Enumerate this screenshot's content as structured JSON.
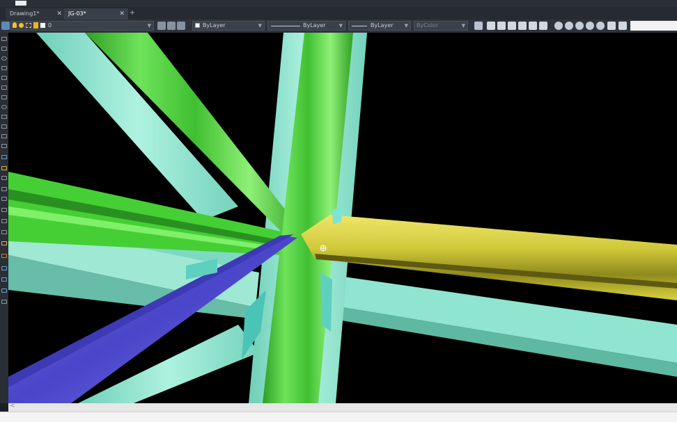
{
  "app": {
    "title": ""
  },
  "tabs": [
    {
      "label": "Drawing1*",
      "active": false
    },
    {
      "label": "JG-03*",
      "active": true
    }
  ],
  "toolbar": {
    "layer_value": "0",
    "color_value": "ByLayer",
    "linetype_value": "ByLayer",
    "lineweight_value": "ByLayer",
    "plotstyle_value": "ByColor"
  },
  "colors": {
    "green_member": "#4bd634",
    "yellow_member": "#d9d23f",
    "blue_member": "#5a56d9",
    "teal_member": "#8fe5cf",
    "background": "#000000"
  },
  "command": {
    "prompt": ""
  }
}
